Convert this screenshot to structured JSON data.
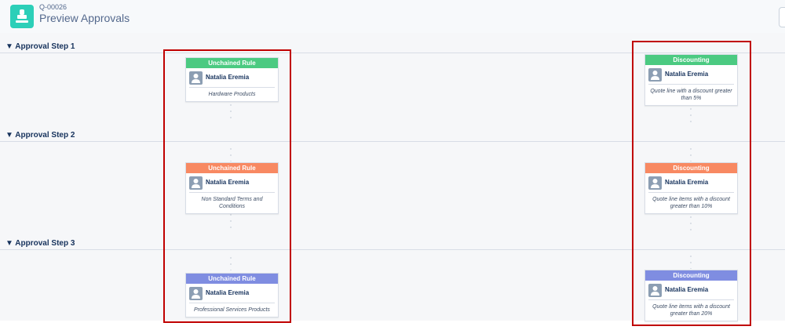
{
  "header": {
    "record_id": "Q-00026",
    "title": "Preview Approvals"
  },
  "steps": [
    {
      "label": "▼ Approval Step 1"
    },
    {
      "label": "▼ Approval Step 2"
    },
    {
      "label": "▼ Approval Step 3"
    }
  ],
  "columns": {
    "left": {
      "cards": [
        {
          "header": "Unchained Rule",
          "color": "#4bca81",
          "approver": "Natalia Eremia",
          "description": "Hardware Products"
        },
        {
          "header": "Unchained Rule",
          "color": "#f88962",
          "approver": "Natalia Eremia",
          "description": "Non Standard Terms and Conditions"
        },
        {
          "header": "Unchained Rule",
          "color": "#7f8de1",
          "approver": "Natalia Eremia",
          "description": "Professional Services Products"
        }
      ]
    },
    "right": {
      "cards": [
        {
          "header": "Discounting",
          "color": "#4bca81",
          "approver": "Natalia Eremia",
          "description": "Quote line with a discount greater than 5%"
        },
        {
          "header": "Discounting",
          "color": "#f88962",
          "approver": "Natalia Eremia",
          "description": "Quote line items with a discount greater than 10%"
        },
        {
          "header": "Discounting",
          "color": "#7f8de1",
          "approver": "Natalia Eremia",
          "description": "Quote line items with a discount greater than 20%"
        }
      ]
    }
  },
  "annotation_color": "#c00000"
}
